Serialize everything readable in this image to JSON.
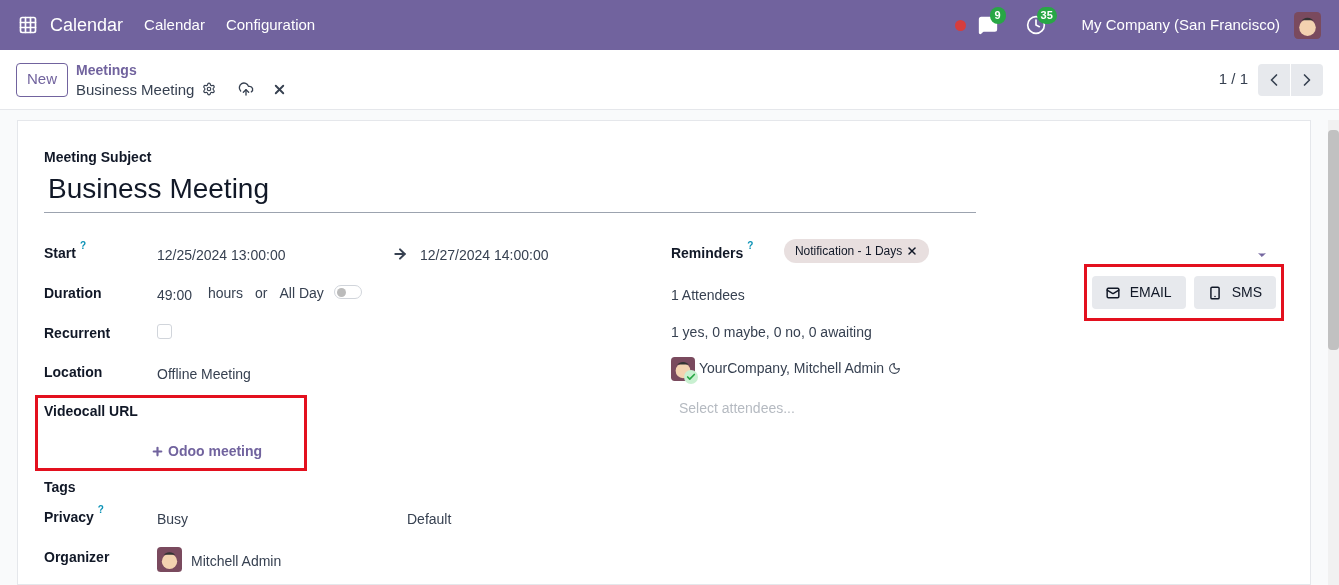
{
  "navbar": {
    "app": "Calendar",
    "menu": [
      "Calendar",
      "Configuration"
    ],
    "messages_count": "9",
    "activities_count": "35",
    "company": "My Company (San Francisco)"
  },
  "control_panel": {
    "new_button": "New",
    "breadcrumb": "Meetings",
    "record": "Business Meeting",
    "pager": "1 / 1"
  },
  "form": {
    "subject_label": "Meeting Subject",
    "subject": "Business Meeting",
    "start": {
      "label": "Start",
      "help": "?",
      "from": "12/25/2024 13:00:00",
      "to": "12/27/2024 14:00:00"
    },
    "duration": {
      "label": "Duration",
      "value": "49:00",
      "unit": "hours",
      "or": "or",
      "all_day_label": "All Day",
      "all_day_on": false
    },
    "recurrent": {
      "label": "Recurrent",
      "checked": false
    },
    "location": {
      "label": "Location",
      "value": "Offline Meeting"
    },
    "videocall": {
      "label": "Videocall URL",
      "action": "Odoo meeting",
      "highlighted": true
    },
    "tags": {
      "label": "Tags"
    },
    "privacy": {
      "label": "Privacy",
      "help": "?",
      "value": "Busy",
      "show_as": "Default"
    },
    "organizer": {
      "label": "Organizer",
      "value": "Mitchell Admin"
    },
    "reminders": {
      "label": "Reminders",
      "help": "?",
      "tags": [
        "Notification - 1 Days"
      ]
    },
    "attendees_count": "1 Attendees",
    "attendees_summary": "1 yes, 0 maybe, 0 no, 0 awaiting",
    "attendees": [
      {
        "name": "YourCompany, Mitchell Admin",
        "accepted": true
      }
    ],
    "attendees_placeholder": "Select attendees...",
    "actions": {
      "highlighted": true,
      "buttons": [
        {
          "kind": "email",
          "label": "EMAIL"
        },
        {
          "kind": "sms",
          "label": "SMS"
        }
      ]
    }
  }
}
